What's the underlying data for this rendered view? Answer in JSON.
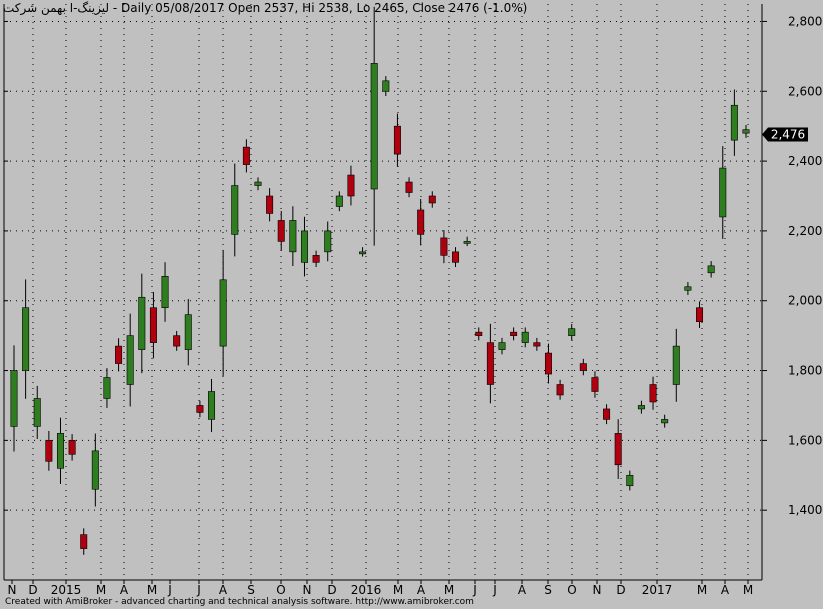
{
  "header": {
    "title": "لیزینگ-ا بهمن شرکت - Daily 05/08/2017 Open 2537, Hi 2538, Lo 2465, Close 2476 (-1.0%)"
  },
  "footer": {
    "credit": "Created with AmiBroker - advanced charting and technical analysis software. http://www.amibroker.com"
  },
  "colors": {
    "background": "#c0c0c0",
    "up": "#2e7d1e",
    "down": "#b00010",
    "wick": "#000000",
    "grid": "#000000",
    "last_price_bg": "#000000",
    "last_price_text": "#ffffff"
  },
  "chart_data": {
    "type": "candlestick",
    "title": "",
    "xlabel": "",
    "ylabel": "",
    "ylim": [
      1200,
      2850
    ],
    "grid": true,
    "y_ticks": [
      1400,
      1600,
      1800,
      2000,
      2200,
      2400,
      2600,
      2800
    ],
    "y_tick_labels": [
      "1,400",
      "1,600",
      "1,800",
      "2,000",
      "2,200",
      "2,400",
      "2,600",
      "2,800"
    ],
    "x_tick_labels": [
      "N",
      "D",
      "2015",
      "M",
      "A",
      "M",
      "J",
      "J",
      "A",
      "S",
      "O",
      "N",
      "D",
      "2016",
      "M",
      "A",
      "M",
      "J",
      "J",
      "A",
      "S",
      "O",
      "N",
      "D",
      "2017",
      "M",
      "A",
      "M"
    ],
    "last_price": 2476,
    "last_price_label": "2,476",
    "last_bar": {
      "date": "05/08/2017",
      "open": 2537,
      "high": 2538,
      "low": 2465,
      "close": 2476
    },
    "series": [
      {
        "values": [
          [
            1640,
            1800
          ],
          [
            1800,
            1980
          ],
          [
            1640,
            1720
          ],
          [
            1600,
            1540
          ],
          [
            1520,
            1620
          ],
          [
            1600,
            1560
          ],
          [
            1330,
            1290
          ],
          [
            1460,
            1570
          ],
          [
            1720,
            1780
          ],
          [
            1870,
            1820
          ],
          [
            1760,
            1900
          ],
          [
            1860,
            2010
          ],
          [
            1980,
            1880
          ],
          [
            1980,
            2070
          ],
          [
            1900,
            1870
          ],
          [
            1860,
            1960
          ],
          [
            1700,
            1680
          ],
          [
            1660,
            1740
          ],
          [
            1870,
            2060
          ],
          [
            2190,
            2330
          ],
          [
            2440,
            2390
          ],
          [
            2330,
            2340
          ],
          [
            2300,
            2250
          ],
          [
            2230,
            2170
          ],
          [
            2140,
            2230
          ],
          [
            2110,
            2200
          ],
          [
            2130,
            2110
          ],
          [
            2140,
            2200
          ],
          [
            2270,
            2300
          ],
          [
            2360,
            2300
          ],
          [
            2140,
            2140
          ],
          [
            2320,
            2680
          ],
          [
            2600,
            2630
          ],
          [
            2500,
            2420
          ],
          [
            2340,
            2310
          ],
          [
            2260,
            2190
          ],
          [
            2300,
            2280
          ],
          [
            2180,
            2130
          ],
          [
            2140,
            2110
          ],
          [
            2170,
            2170
          ],
          [
            1910,
            1900
          ],
          [
            1880,
            1760
          ],
          [
            1860,
            1880
          ],
          [
            1910,
            1900
          ],
          [
            1880,
            1910
          ],
          [
            1880,
            1870
          ],
          [
            1850,
            1790
          ],
          [
            1760,
            1730
          ],
          [
            1900,
            1920
          ],
          [
            1820,
            1800
          ],
          [
            1780,
            1740
          ],
          [
            1690,
            1660
          ],
          [
            1620,
            1530
          ],
          [
            1470,
            1500
          ],
          [
            1690,
            1700
          ],
          [
            1760,
            1710
          ],
          [
            1650,
            1660
          ],
          [
            1760,
            1870
          ],
          [
            2030,
            2040
          ],
          [
            1980,
            1940
          ],
          [
            2080,
            2100
          ],
          [
            2240,
            2380
          ],
          [
            2460,
            2560
          ],
          [
            2480,
            2490
          ]
        ]
      }
    ]
  }
}
